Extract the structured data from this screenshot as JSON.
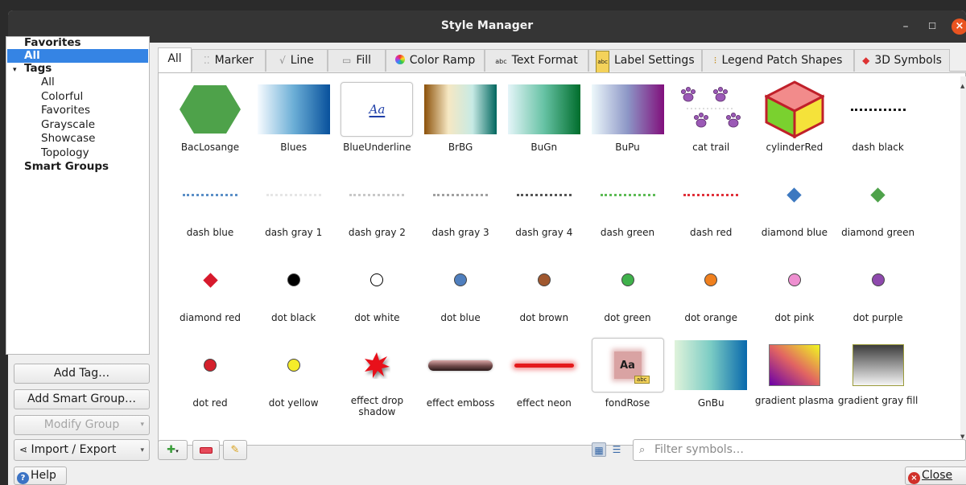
{
  "window": {
    "title": "Style Manager"
  },
  "tree": {
    "favorites": "Favorites",
    "all": "All",
    "tags": "Tags",
    "tag_items": [
      "All",
      "Colorful",
      "Favorites",
      "Grayscale",
      "Showcase",
      "Topology"
    ],
    "smart_groups": "Smart Groups"
  },
  "left_buttons": {
    "add_tag": "Add Tag…",
    "add_smart_group": "Add Smart Group…",
    "modify_group": "Modify Group",
    "import_export": "Import / Export"
  },
  "tabs": [
    "All",
    "Marker",
    "Line",
    "Fill",
    "Color Ramp",
    "Text Format",
    "Label Settings",
    "Legend Patch Shapes",
    "3D Symbols"
  ],
  "symbols": [
    {
      "name": "BacLosange",
      "kind": "hexagon",
      "color": "#4ea24a"
    },
    {
      "name": "Blues",
      "kind": "gradient",
      "colors": [
        "#f7fbff",
        "#6baed6",
        "#08519c"
      ]
    },
    {
      "name": "BlueUnderline",
      "kind": "text",
      "text": "Aa"
    },
    {
      "name": "BrBG",
      "kind": "gradient",
      "colors": [
        "#8c510a",
        "#f6e8c3",
        "#c7eae5",
        "#01665e"
      ]
    },
    {
      "name": "BuGn",
      "kind": "gradient",
      "colors": [
        "#e5f5f9",
        "#66c2a4",
        "#006d2c"
      ]
    },
    {
      "name": "BuPu",
      "kind": "gradient",
      "colors": [
        "#edf8fb",
        "#8c96c6",
        "#810f7c"
      ]
    },
    {
      "name": "cat trail",
      "kind": "paws",
      "color": "#9b59b6"
    },
    {
      "name": "cylinderRed",
      "kind": "cube"
    },
    {
      "name": "dash  black",
      "kind": "dash",
      "color": "#1a1a1a"
    },
    {
      "name": "dash blue",
      "kind": "dash",
      "color": "#5b8fc7"
    },
    {
      "name": "dash gray 1",
      "kind": "dash",
      "color": "#e6e6e6"
    },
    {
      "name": "dash gray 2",
      "kind": "dash",
      "color": "#c8c8c8"
    },
    {
      "name": "dash gray 3",
      "kind": "dash",
      "color": "#a0a0a0"
    },
    {
      "name": "dash gray 4",
      "kind": "dash",
      "color": "#555555"
    },
    {
      "name": "dash green",
      "kind": "dash",
      "color": "#5dbb55"
    },
    {
      "name": "dash red",
      "kind": "dash",
      "color": "#e0303a"
    },
    {
      "name": "diamond blue",
      "kind": "diamond",
      "color": "#3c78c0"
    },
    {
      "name": "diamond green",
      "kind": "diamond",
      "color": "#4ea24a"
    },
    {
      "name": "diamond red",
      "kind": "diamond",
      "color": "#d7192c"
    },
    {
      "name": "dot  black",
      "kind": "dot",
      "color": "#000000"
    },
    {
      "name": "dot  white",
      "kind": "dot",
      "color": "#ffffff"
    },
    {
      "name": "dot blue",
      "kind": "dot",
      "color": "#4f7fbe"
    },
    {
      "name": "dot brown",
      "kind": "dot",
      "color": "#a0582f"
    },
    {
      "name": "dot green",
      "kind": "dot",
      "color": "#3fb14b"
    },
    {
      "name": "dot orange",
      "kind": "dot",
      "color": "#f0801e"
    },
    {
      "name": "dot pink",
      "kind": "dot",
      "color": "#ee8fd0"
    },
    {
      "name": "dot purple",
      "kind": "dot",
      "color": "#8e49ad"
    },
    {
      "name": "dot red",
      "kind": "dot",
      "color": "#d4202c"
    },
    {
      "name": "dot yellow",
      "kind": "dot",
      "color": "#f5ec2a"
    },
    {
      "name": "effect drop shadow",
      "kind": "star",
      "color": "#e8101a"
    },
    {
      "name": "effect emboss",
      "kind": "emboss"
    },
    {
      "name": "effect neon",
      "kind": "neon",
      "color": "#e41a1c"
    },
    {
      "name": "fondRose",
      "kind": "fondrose",
      "text": "Aa",
      "badge": "abc"
    },
    {
      "name": "GnBu",
      "kind": "gradient",
      "colors": [
        "#e0f3db",
        "#7bccc4",
        "#0868ac"
      ]
    },
    {
      "name": "gradient plasma",
      "kind": "plasma",
      "colors": [
        "#f0f921",
        "#e16462",
        "#6a00a8"
      ]
    },
    {
      "name": "gradient gray fill",
      "kind": "grayfill",
      "colors": [
        "#3c3c3c",
        "#f5f5f5"
      ]
    }
  ],
  "filter": {
    "placeholder": "Filter symbols…"
  },
  "buttons": {
    "help": "Help",
    "close": "Close"
  }
}
